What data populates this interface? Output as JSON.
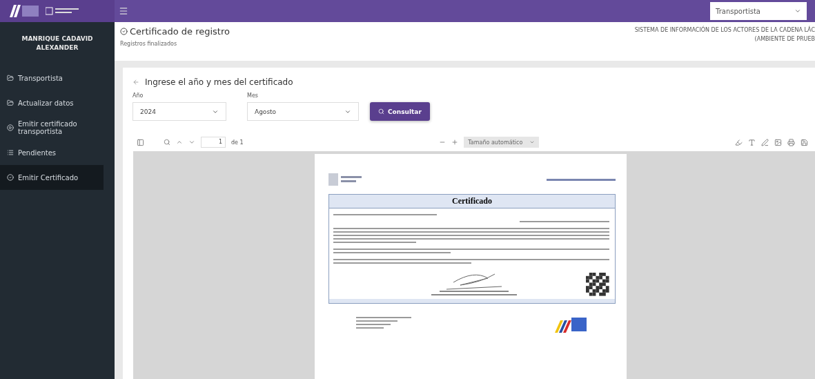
{
  "topbar": {
    "role_select": "Transportista"
  },
  "sidebar": {
    "user": "MANRIQUE CADAVID ALEXANDER",
    "items": [
      {
        "label": "Transportista",
        "selected": false
      },
      {
        "label": "Actualizar datos",
        "selected": false
      },
      {
        "label": "Emitir certificado transportista",
        "selected": false
      },
      {
        "label": "Pendientes",
        "selected": false
      },
      {
        "label": "Emitir Certificado",
        "selected": true
      }
    ]
  },
  "header": {
    "title": "Certificado de registro",
    "subtitle": "Registros finalizados",
    "system_name": "SISTEMA DE INFORMACIÓN DE LOS ACTORES DE LA CADENA LÁC",
    "environment": "(AMBIENTE DE PRUEB"
  },
  "form": {
    "heading": "Ingrese el año y mes del certificado",
    "year": {
      "label": "Año",
      "value": "2024"
    },
    "month": {
      "label": "Mes",
      "value": "Agosto"
    },
    "button": "Consultar"
  },
  "viewer": {
    "page": "1",
    "page_count": "de 1",
    "zoom": "Tamaño automático",
    "document": {
      "title": "Certificado"
    }
  }
}
